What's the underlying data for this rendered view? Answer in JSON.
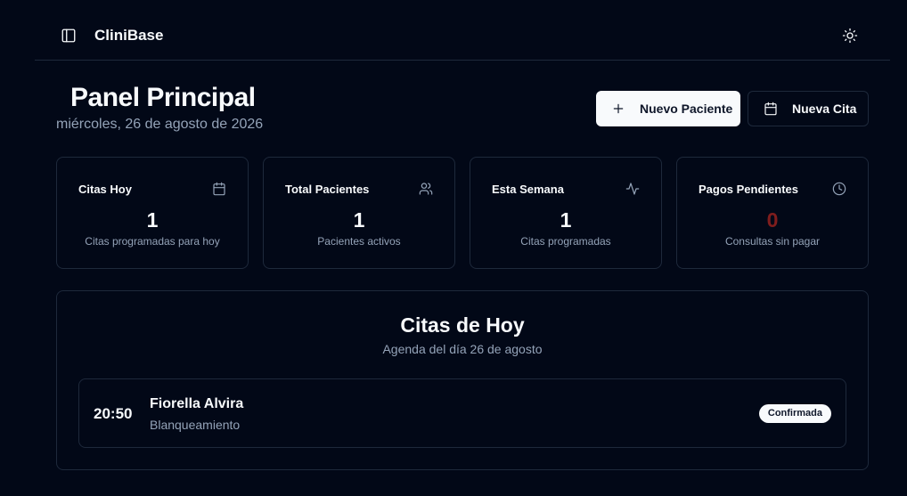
{
  "header": {
    "app_title": "CliniBase",
    "icons": {
      "sidebar_toggle": "panel-left-icon",
      "theme_toggle": "sun-icon"
    }
  },
  "page": {
    "title": "Panel Principal",
    "date": "miércoles, 26 de agosto de 2026"
  },
  "actions": {
    "new_patient_label": "Nuevo Paciente",
    "new_appointment_label": "Nueva Cita"
  },
  "stats": [
    {
      "title": "Citas Hoy",
      "value": "1",
      "subtitle": "Citas programadas para hoy",
      "icon": "calendar-icon"
    },
    {
      "title": "Total Pacientes",
      "value": "1",
      "subtitle": "Pacientes activos",
      "icon": "users-icon"
    },
    {
      "title": "Esta Semana",
      "value": "1",
      "subtitle": "Citas programadas",
      "icon": "activity-icon"
    },
    {
      "title": "Pagos Pendientes",
      "value": "0",
      "subtitle": "Consultas sin pagar",
      "icon": "clock-icon",
      "value_color": "#7f1d1d"
    }
  ],
  "today": {
    "title": "Citas de Hoy",
    "subtitle": "Agenda del día 26 de agosto",
    "appointments": [
      {
        "time": "20:50",
        "patient": "Fiorella Alvira",
        "treatment": "Blanqueamiento",
        "status": "Confirmada"
      }
    ]
  },
  "colors": {
    "background": "#020817",
    "border": "#1e293b",
    "text": "#f8fafc",
    "muted": "#94a3b8",
    "danger": "#7f1d1d"
  }
}
